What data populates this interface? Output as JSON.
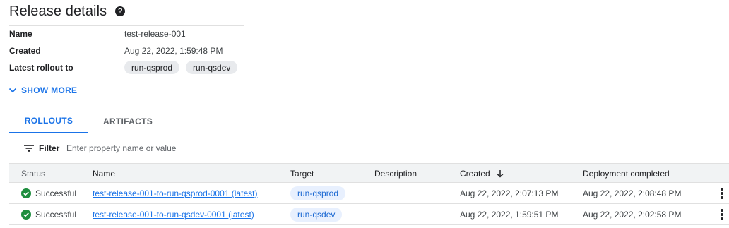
{
  "page": {
    "title": "Release details",
    "help_icon": "help-circle-icon"
  },
  "details": [
    {
      "label": "Name",
      "value": "test-release-001"
    },
    {
      "label": "Created",
      "value": "Aug 22, 2022, 1:59:48 PM"
    },
    {
      "label": "Latest rollout to",
      "chips": [
        "run-qsprod",
        "run-qsdev"
      ]
    }
  ],
  "show_more": {
    "label": "SHOW MORE",
    "icon": "chevron-down-icon"
  },
  "tabs": [
    {
      "label": "ROLLOUTS",
      "active": true
    },
    {
      "label": "ARTIFACTS",
      "active": false
    }
  ],
  "filter": {
    "icon": "filter-list-icon",
    "label": "Filter",
    "placeholder": "Enter property name or value"
  },
  "table": {
    "columns": [
      "Status",
      "Name",
      "Target",
      "Description",
      "Created",
      "Deployment completed"
    ],
    "sort_column": "Created",
    "sort_direction": "descending",
    "rows": [
      {
        "status": "Successful",
        "name": "test-release-001-to-run-qsprod-0001 (latest)",
        "target": "run-qsprod",
        "description": "",
        "created": "Aug 22, 2022, 2:07:13 PM",
        "completed": "Aug 22, 2022, 2:08:48 PM"
      },
      {
        "status": "Successful",
        "name": "test-release-001-to-run-qsdev-0001 (latest)",
        "target": "run-qsdev",
        "description": "",
        "created": "Aug 22, 2022, 1:59:51 PM",
        "completed": "Aug 22, 2022, 2:02:58 PM"
      }
    ]
  },
  "colors": {
    "accent": "#1a73e8",
    "success": "#1e8e3e",
    "chip_bg": "#e8eaed",
    "target_chip_bg": "#e8f0fe",
    "header_bg": "#f1f3f4"
  }
}
